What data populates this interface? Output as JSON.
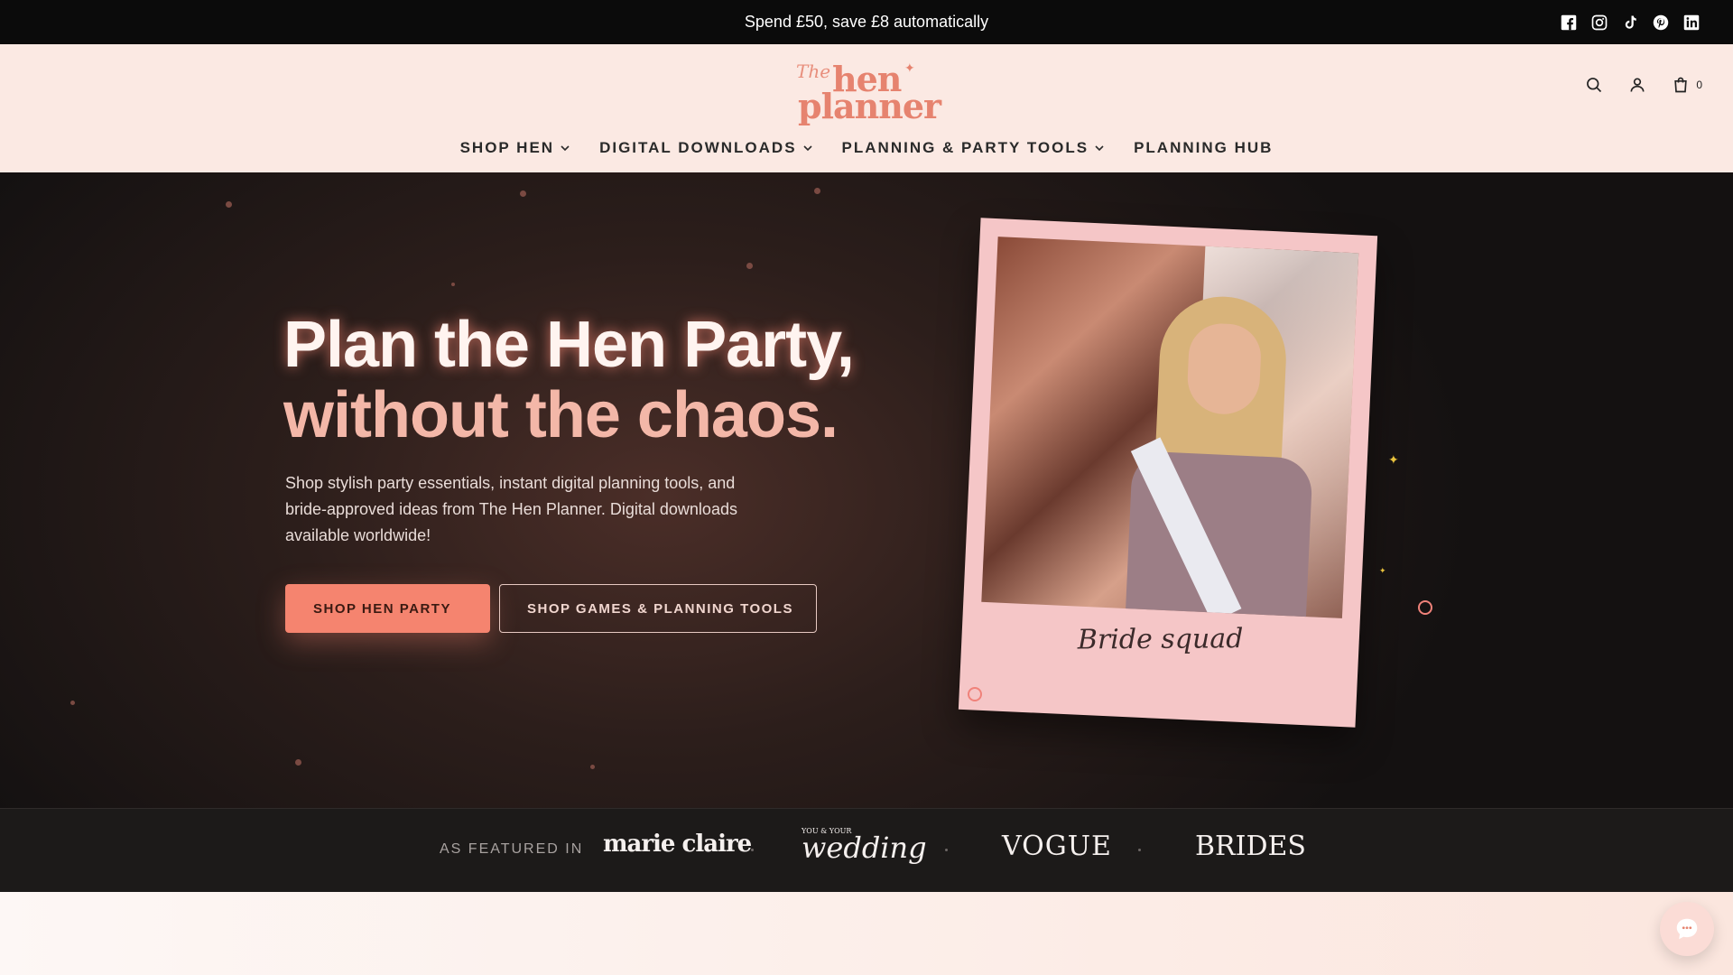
{
  "announcement": {
    "text": "Spend £50, save £8 automatically"
  },
  "social_icons": [
    "facebook-icon",
    "instagram-icon",
    "tiktok-icon",
    "pinterest-icon",
    "linkedin-icon"
  ],
  "logo": {
    "the": "The",
    "hen": "hen",
    "planner": "planner",
    "tm": "™"
  },
  "header": {
    "cart_count": "0"
  },
  "nav": {
    "items": [
      {
        "label": "SHOP HEN",
        "has_chevron": true
      },
      {
        "label": "DIGITAL DOWNLOADS",
        "has_chevron": true
      },
      {
        "label": "PLANNING & PARTY TOOLS",
        "has_chevron": true
      },
      {
        "label": "PLANNING HUB",
        "has_chevron": false
      }
    ]
  },
  "hero": {
    "title_line1": "Plan the Hen Party,",
    "title_line2": "without the chaos.",
    "subtitle": "Shop stylish party essentials, instant digital planning tools, and bride-approved ideas from The Hen Planner. Digital downloads available worldwide!",
    "primary_button": "SHOP HEN PARTY",
    "secondary_button": "SHOP GAMES & PLANNING TOOLS",
    "polaroid_caption": "Bride squad"
  },
  "featured": {
    "label": "AS FEATURED IN",
    "brands": [
      "marie claire",
      "wedding",
      "VOGUE",
      "BRIDES"
    ],
    "wedding_prefix": "YOU & YOUR"
  },
  "colors": {
    "accent": "#f5846f",
    "header_bg": "#fbe9e3",
    "announcement_bg": "#0b0b0b",
    "hero_dark": "#1a1414",
    "featured_bg": "#1c1a19"
  }
}
